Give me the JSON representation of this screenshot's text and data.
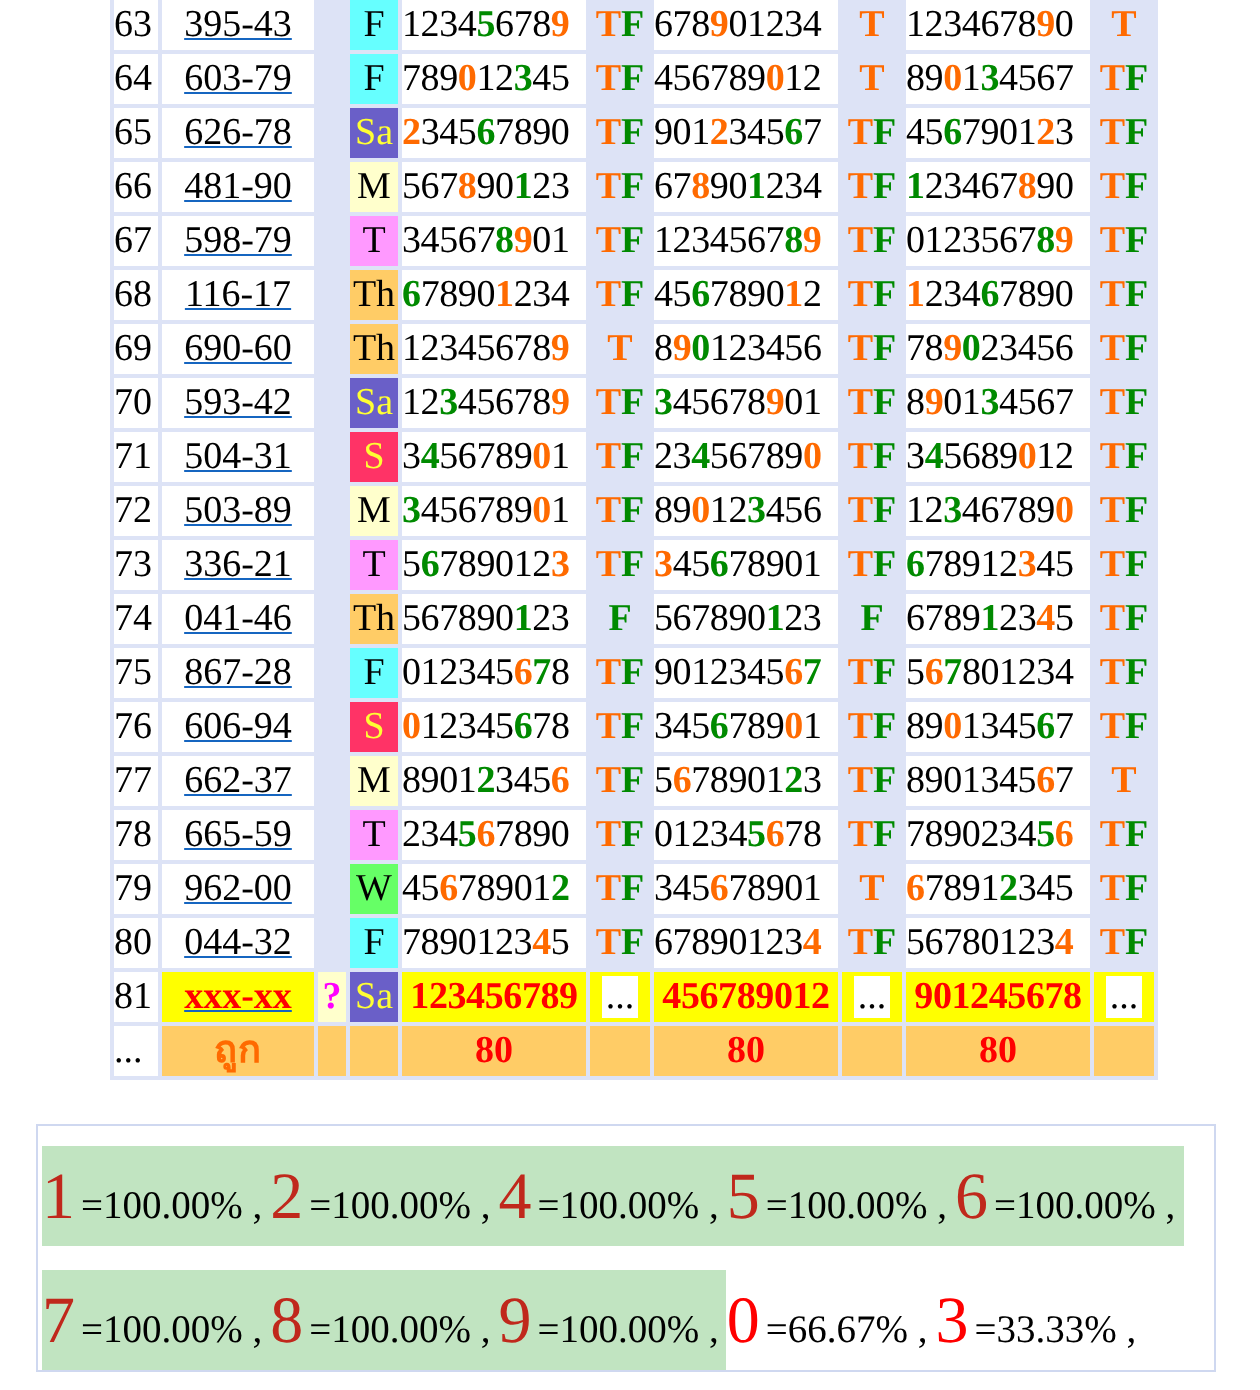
{
  "rows": [
    {
      "n": "63",
      "code": "395-43",
      "day": "F",
      "color": "#66ffff",
      "kind": "past",
      "cells": [
        [
          {
            "text": "1234",
            "color": "#000000"
          },
          {
            "text": "5",
            "color": "#008a00"
          },
          {
            "text": "678",
            "color": "#000000"
          },
          {
            "text": "9",
            "color": "#ff6a00"
          }
        ],
        [
          {
            "text": "T",
            "color": "#ff6a00"
          },
          {
            "text": "F",
            "color": "#008a00"
          }
        ],
        [
          {
            "text": "678",
            "color": "#000000"
          },
          {
            "text": "9",
            "color": "#ff6a00"
          },
          {
            "text": "01234",
            "color": "#000000"
          }
        ],
        [
          {
            "text": "T",
            "color": "#ff6a00"
          }
        ],
        [
          {
            "text": "1234678",
            "color": "#000000"
          },
          {
            "text": "9",
            "color": "#ff6a00"
          },
          {
            "text": "0",
            "color": "#000000"
          }
        ],
        [
          {
            "text": "T",
            "color": "#ff6a00"
          }
        ]
      ]
    },
    {
      "n": "64",
      "code": "603-79",
      "day": "F",
      "color": "#66ffff",
      "kind": "past",
      "cells": [
        [
          {
            "text": "789",
            "color": "#000000"
          },
          {
            "text": "0",
            "color": "#ff6a00"
          },
          {
            "text": "12",
            "color": "#000000"
          },
          {
            "text": "3",
            "color": "#008a00"
          },
          {
            "text": "45",
            "color": "#000000"
          }
        ],
        [
          {
            "text": "T",
            "color": "#ff6a00"
          },
          {
            "text": "F",
            "color": "#008a00"
          }
        ],
        [
          {
            "text": "456789",
            "color": "#000000"
          },
          {
            "text": "0",
            "color": "#ff6a00"
          },
          {
            "text": "12",
            "color": "#000000"
          }
        ],
        [
          {
            "text": "T",
            "color": "#ff6a00"
          }
        ],
        [
          {
            "text": "89",
            "color": "#000000"
          },
          {
            "text": "0",
            "color": "#ff6a00"
          },
          {
            "text": "1",
            "color": "#000000"
          },
          {
            "text": "3",
            "color": "#008a00"
          },
          {
            "text": "4567",
            "color": "#000000"
          }
        ],
        [
          {
            "text": "T",
            "color": "#ff6a00"
          },
          {
            "text": "F",
            "color": "#008a00"
          }
        ]
      ]
    },
    {
      "n": "65",
      "code": "626-78",
      "day": "Sa",
      "color": "#6a5fc8",
      "kind": "past",
      "cells": [
        [
          {
            "text": "2",
            "color": "#ff6a00"
          },
          {
            "text": "345",
            "color": "#000000"
          },
          {
            "text": "6",
            "color": "#008a00"
          },
          {
            "text": "7890",
            "color": "#000000"
          }
        ],
        [
          {
            "text": "T",
            "color": "#ff6a00"
          },
          {
            "text": "F",
            "color": "#008a00"
          }
        ],
        [
          {
            "text": "901",
            "color": "#000000"
          },
          {
            "text": "2",
            "color": "#ff6a00"
          },
          {
            "text": "345",
            "color": "#000000"
          },
          {
            "text": "6",
            "color": "#008a00"
          },
          {
            "text": "7",
            "color": "#000000"
          }
        ],
        [
          {
            "text": "T",
            "color": "#ff6a00"
          },
          {
            "text": "F",
            "color": "#008a00"
          }
        ],
        [
          {
            "text": "45",
            "color": "#000000"
          },
          {
            "text": "6",
            "color": "#008a00"
          },
          {
            "text": "7901",
            "color": "#000000"
          },
          {
            "text": "2",
            "color": "#ff6a00"
          },
          {
            "text": "3",
            "color": "#000000"
          }
        ],
        [
          {
            "text": "T",
            "color": "#ff6a00"
          },
          {
            "text": "F",
            "color": "#008a00"
          }
        ]
      ]
    },
    {
      "n": "66",
      "code": "481-90",
      "day": "M",
      "color": "#ffffcc",
      "kind": "past",
      "cells": [
        [
          {
            "text": "567",
            "color": "#000000"
          },
          {
            "text": "8",
            "color": "#ff6a00"
          },
          {
            "text": "90",
            "color": "#000000"
          },
          {
            "text": "1",
            "color": "#008a00"
          },
          {
            "text": "23",
            "color": "#000000"
          }
        ],
        [
          {
            "text": "T",
            "color": "#ff6a00"
          },
          {
            "text": "F",
            "color": "#008a00"
          }
        ],
        [
          {
            "text": "67",
            "color": "#000000"
          },
          {
            "text": "8",
            "color": "#ff6a00"
          },
          {
            "text": "90",
            "color": "#000000"
          },
          {
            "text": "1",
            "color": "#008a00"
          },
          {
            "text": "234",
            "color": "#000000"
          }
        ],
        [
          {
            "text": "T",
            "color": "#ff6a00"
          },
          {
            "text": "F",
            "color": "#008a00"
          }
        ],
        [
          {
            "text": "1",
            "color": "#008a00"
          },
          {
            "text": "23467",
            "color": "#000000"
          },
          {
            "text": "8",
            "color": "#ff6a00"
          },
          {
            "text": "90",
            "color": "#000000"
          }
        ],
        [
          {
            "text": "T",
            "color": "#ff6a00"
          },
          {
            "text": "F",
            "color": "#008a00"
          }
        ]
      ]
    },
    {
      "n": "67",
      "code": "598-79",
      "day": "T",
      "color": "#ff99ff",
      "kind": "past",
      "cells": [
        [
          {
            "text": "34567",
            "color": "#000000"
          },
          {
            "text": "8",
            "color": "#008a00"
          },
          {
            "text": "9",
            "color": "#ff6a00"
          },
          {
            "text": "01",
            "color": "#000000"
          }
        ],
        [
          {
            "text": "T",
            "color": "#ff6a00"
          },
          {
            "text": "F",
            "color": "#008a00"
          }
        ],
        [
          {
            "text": "1234567",
            "color": "#000000"
          },
          {
            "text": "8",
            "color": "#008a00"
          },
          {
            "text": "9",
            "color": "#ff6a00"
          }
        ],
        [
          {
            "text": "T",
            "color": "#ff6a00"
          },
          {
            "text": "F",
            "color": "#008a00"
          }
        ],
        [
          {
            "text": "0123567",
            "color": "#000000"
          },
          {
            "text": "8",
            "color": "#008a00"
          },
          {
            "text": "9",
            "color": "#ff6a00"
          }
        ],
        [
          {
            "text": "T",
            "color": "#ff6a00"
          },
          {
            "text": "F",
            "color": "#008a00"
          }
        ]
      ]
    },
    {
      "n": "68",
      "code": "116-17",
      "day": "Th",
      "color": "#ffcc66",
      "kind": "past",
      "cells": [
        [
          {
            "text": "6",
            "color": "#008a00"
          },
          {
            "text": "7890",
            "color": "#000000"
          },
          {
            "text": "1",
            "color": "#ff6a00"
          },
          {
            "text": "234",
            "color": "#000000"
          }
        ],
        [
          {
            "text": "T",
            "color": "#ff6a00"
          },
          {
            "text": "F",
            "color": "#008a00"
          }
        ],
        [
          {
            "text": "45",
            "color": "#000000"
          },
          {
            "text": "6",
            "color": "#008a00"
          },
          {
            "text": "7890",
            "color": "#000000"
          },
          {
            "text": "1",
            "color": "#ff6a00"
          },
          {
            "text": "2",
            "color": "#000000"
          }
        ],
        [
          {
            "text": "T",
            "color": "#ff6a00"
          },
          {
            "text": "F",
            "color": "#008a00"
          }
        ],
        [
          {
            "text": "1",
            "color": "#ff6a00"
          },
          {
            "text": "234",
            "color": "#000000"
          },
          {
            "text": "6",
            "color": "#008a00"
          },
          {
            "text": "7890",
            "color": "#000000"
          }
        ],
        [
          {
            "text": "T",
            "color": "#ff6a00"
          },
          {
            "text": "F",
            "color": "#008a00"
          }
        ]
      ]
    },
    {
      "n": "69",
      "code": "690-60",
      "day": "Th",
      "color": "#ffcc66",
      "kind": "past",
      "cells": [
        [
          {
            "text": "12345678",
            "color": "#000000"
          },
          {
            "text": "9",
            "color": "#ff6a00"
          }
        ],
        [
          {
            "text": "T",
            "color": "#ff6a00"
          }
        ],
        [
          {
            "text": "8",
            "color": "#000000"
          },
          {
            "text": "9",
            "color": "#ff6a00"
          },
          {
            "text": "0",
            "color": "#008a00"
          },
          {
            "text": "123456",
            "color": "#000000"
          }
        ],
        [
          {
            "text": "T",
            "color": "#ff6a00"
          },
          {
            "text": "F",
            "color": "#008a00"
          }
        ],
        [
          {
            "text": "78",
            "color": "#000000"
          },
          {
            "text": "9",
            "color": "#ff6a00"
          },
          {
            "text": "0",
            "color": "#008a00"
          },
          {
            "text": "23456",
            "color": "#000000"
          }
        ],
        [
          {
            "text": "T",
            "color": "#ff6a00"
          },
          {
            "text": "F",
            "color": "#008a00"
          }
        ]
      ]
    },
    {
      "n": "70",
      "code": "593-42",
      "day": "Sa",
      "color": "#6a5fc8",
      "kind": "past",
      "cells": [
        [
          {
            "text": "12",
            "color": "#000000"
          },
          {
            "text": "3",
            "color": "#008a00"
          },
          {
            "text": "45678",
            "color": "#000000"
          },
          {
            "text": "9",
            "color": "#ff6a00"
          }
        ],
        [
          {
            "text": "T",
            "color": "#ff6a00"
          },
          {
            "text": "F",
            "color": "#008a00"
          }
        ],
        [
          {
            "text": "3",
            "color": "#008a00"
          },
          {
            "text": "45678",
            "color": "#000000"
          },
          {
            "text": "9",
            "color": "#ff6a00"
          },
          {
            "text": "01",
            "color": "#000000"
          }
        ],
        [
          {
            "text": "T",
            "color": "#ff6a00"
          },
          {
            "text": "F",
            "color": "#008a00"
          }
        ],
        [
          {
            "text": "8",
            "color": "#000000"
          },
          {
            "text": "9",
            "color": "#ff6a00"
          },
          {
            "text": "01",
            "color": "#000000"
          },
          {
            "text": "3",
            "color": "#008a00"
          },
          {
            "text": "4567",
            "color": "#000000"
          }
        ],
        [
          {
            "text": "T",
            "color": "#ff6a00"
          },
          {
            "text": "F",
            "color": "#008a00"
          }
        ]
      ]
    },
    {
      "n": "71",
      "code": "504-31",
      "day": "S",
      "color": "#ff3366",
      "kind": "past",
      "cells": [
        [
          {
            "text": "3",
            "color": "#000000"
          },
          {
            "text": "4",
            "color": "#008a00"
          },
          {
            "text": "56789",
            "color": "#000000"
          },
          {
            "text": "0",
            "color": "#ff6a00"
          },
          {
            "text": "1",
            "color": "#000000"
          }
        ],
        [
          {
            "text": "T",
            "color": "#ff6a00"
          },
          {
            "text": "F",
            "color": "#008a00"
          }
        ],
        [
          {
            "text": "23",
            "color": "#000000"
          },
          {
            "text": "4",
            "color": "#008a00"
          },
          {
            "text": "56789",
            "color": "#000000"
          },
          {
            "text": "0",
            "color": "#ff6a00"
          }
        ],
        [
          {
            "text": "T",
            "color": "#ff6a00"
          },
          {
            "text": "F",
            "color": "#008a00"
          }
        ],
        [
          {
            "text": "3",
            "color": "#000000"
          },
          {
            "text": "4",
            "color": "#008a00"
          },
          {
            "text": "5689",
            "color": "#000000"
          },
          {
            "text": "0",
            "color": "#ff6a00"
          },
          {
            "text": "12",
            "color": "#000000"
          }
        ],
        [
          {
            "text": "T",
            "color": "#ff6a00"
          },
          {
            "text": "F",
            "color": "#008a00"
          }
        ]
      ]
    },
    {
      "n": "72",
      "code": "503-89",
      "day": "M",
      "color": "#ffffcc",
      "kind": "past",
      "cells": [
        [
          {
            "text": "3",
            "color": "#008a00"
          },
          {
            "text": "456789",
            "color": "#000000"
          },
          {
            "text": "0",
            "color": "#ff6a00"
          },
          {
            "text": "1",
            "color": "#000000"
          }
        ],
        [
          {
            "text": "T",
            "color": "#ff6a00"
          },
          {
            "text": "F",
            "color": "#008a00"
          }
        ],
        [
          {
            "text": "89",
            "color": "#000000"
          },
          {
            "text": "0",
            "color": "#ff6a00"
          },
          {
            "text": "12",
            "color": "#000000"
          },
          {
            "text": "3",
            "color": "#008a00"
          },
          {
            "text": "456",
            "color": "#000000"
          }
        ],
        [
          {
            "text": "T",
            "color": "#ff6a00"
          },
          {
            "text": "F",
            "color": "#008a00"
          }
        ],
        [
          {
            "text": "12",
            "color": "#000000"
          },
          {
            "text": "3",
            "color": "#008a00"
          },
          {
            "text": "46789",
            "color": "#000000"
          },
          {
            "text": "0",
            "color": "#ff6a00"
          }
        ],
        [
          {
            "text": "T",
            "color": "#ff6a00"
          },
          {
            "text": "F",
            "color": "#008a00"
          }
        ]
      ]
    },
    {
      "n": "73",
      "code": "336-21",
      "day": "T",
      "color": "#ff99ff",
      "kind": "past",
      "cells": [
        [
          {
            "text": "5",
            "color": "#000000"
          },
          {
            "text": "6",
            "color": "#008a00"
          },
          {
            "text": "789012",
            "color": "#000000"
          },
          {
            "text": "3",
            "color": "#ff6a00"
          }
        ],
        [
          {
            "text": "T",
            "color": "#ff6a00"
          },
          {
            "text": "F",
            "color": "#008a00"
          }
        ],
        [
          {
            "text": "3",
            "color": "#ff6a00"
          },
          {
            "text": "45",
            "color": "#000000"
          },
          {
            "text": "6",
            "color": "#008a00"
          },
          {
            "text": "78901",
            "color": "#000000"
          }
        ],
        [
          {
            "text": "T",
            "color": "#ff6a00"
          },
          {
            "text": "F",
            "color": "#008a00"
          }
        ],
        [
          {
            "text": "6",
            "color": "#008a00"
          },
          {
            "text": "78912",
            "color": "#000000"
          },
          {
            "text": "3",
            "color": "#ff6a00"
          },
          {
            "text": "45",
            "color": "#000000"
          }
        ],
        [
          {
            "text": "T",
            "color": "#ff6a00"
          },
          {
            "text": "F",
            "color": "#008a00"
          }
        ]
      ]
    },
    {
      "n": "74",
      "code": "041-46",
      "day": "Th",
      "color": "#ffcc66",
      "kind": "past",
      "cells": [
        [
          {
            "text": "567890",
            "color": "#000000"
          },
          {
            "text": "1",
            "color": "#008a00"
          },
          {
            "text": "23",
            "color": "#000000"
          }
        ],
        [
          {
            "text": "F",
            "color": "#008a00"
          }
        ],
        [
          {
            "text": "567890",
            "color": "#000000"
          },
          {
            "text": "1",
            "color": "#008a00"
          },
          {
            "text": "23",
            "color": "#000000"
          }
        ],
        [
          {
            "text": "F",
            "color": "#008a00"
          }
        ],
        [
          {
            "text": "6789",
            "color": "#000000"
          },
          {
            "text": "1",
            "color": "#008a00"
          },
          {
            "text": "23",
            "color": "#000000"
          },
          {
            "text": "4",
            "color": "#ff6a00"
          },
          {
            "text": "5",
            "color": "#000000"
          }
        ],
        [
          {
            "text": "T",
            "color": "#ff6a00"
          },
          {
            "text": "F",
            "color": "#008a00"
          }
        ]
      ]
    },
    {
      "n": "75",
      "code": "867-28",
      "day": "F",
      "color": "#66ffff",
      "kind": "past",
      "cells": [
        [
          {
            "text": "012345",
            "color": "#000000"
          },
          {
            "text": "6",
            "color": "#ff6a00"
          },
          {
            "text": "7",
            "color": "#008a00"
          },
          {
            "text": "8",
            "color": "#000000"
          }
        ],
        [
          {
            "text": "T",
            "color": "#ff6a00"
          },
          {
            "text": "F",
            "color": "#008a00"
          }
        ],
        [
          {
            "text": "9012345",
            "color": "#000000"
          },
          {
            "text": "6",
            "color": "#ff6a00"
          },
          {
            "text": "7",
            "color": "#008a00"
          }
        ],
        [
          {
            "text": "T",
            "color": "#ff6a00"
          },
          {
            "text": "F",
            "color": "#008a00"
          }
        ],
        [
          {
            "text": "5",
            "color": "#000000"
          },
          {
            "text": "6",
            "color": "#ff6a00"
          },
          {
            "text": "7",
            "color": "#008a00"
          },
          {
            "text": "801234",
            "color": "#000000"
          }
        ],
        [
          {
            "text": "T",
            "color": "#ff6a00"
          },
          {
            "text": "F",
            "color": "#008a00"
          }
        ]
      ]
    },
    {
      "n": "76",
      "code": "606-94",
      "day": "S",
      "color": "#ff3366",
      "kind": "past",
      "cells": [
        [
          {
            "text": "0",
            "color": "#ff6a00"
          },
          {
            "text": "12345",
            "color": "#000000"
          },
          {
            "text": "6",
            "color": "#008a00"
          },
          {
            "text": "78",
            "color": "#000000"
          }
        ],
        [
          {
            "text": "T",
            "color": "#ff6a00"
          },
          {
            "text": "F",
            "color": "#008a00"
          }
        ],
        [
          {
            "text": "345",
            "color": "#000000"
          },
          {
            "text": "6",
            "color": "#008a00"
          },
          {
            "text": "789",
            "color": "#000000"
          },
          {
            "text": "0",
            "color": "#ff6a00"
          },
          {
            "text": "1",
            "color": "#000000"
          }
        ],
        [
          {
            "text": "T",
            "color": "#ff6a00"
          },
          {
            "text": "F",
            "color": "#008a00"
          }
        ],
        [
          {
            "text": "89",
            "color": "#000000"
          },
          {
            "text": "0",
            "color": "#ff6a00"
          },
          {
            "text": "1345",
            "color": "#000000"
          },
          {
            "text": "6",
            "color": "#008a00"
          },
          {
            "text": "7",
            "color": "#000000"
          }
        ],
        [
          {
            "text": "T",
            "color": "#ff6a00"
          },
          {
            "text": "F",
            "color": "#008a00"
          }
        ]
      ]
    },
    {
      "n": "77",
      "code": "662-37",
      "day": "M",
      "color": "#ffffcc",
      "kind": "past",
      "cells": [
        [
          {
            "text": "8901",
            "color": "#000000"
          },
          {
            "text": "2",
            "color": "#008a00"
          },
          {
            "text": "345",
            "color": "#000000"
          },
          {
            "text": "6",
            "color": "#ff6a00"
          }
        ],
        [
          {
            "text": "T",
            "color": "#ff6a00"
          },
          {
            "text": "F",
            "color": "#008a00"
          }
        ],
        [
          {
            "text": "5",
            "color": "#000000"
          },
          {
            "text": "6",
            "color": "#ff6a00"
          },
          {
            "text": "78901",
            "color": "#000000"
          },
          {
            "text": "2",
            "color": "#008a00"
          },
          {
            "text": "3",
            "color": "#000000"
          }
        ],
        [
          {
            "text": "T",
            "color": "#ff6a00"
          },
          {
            "text": "F",
            "color": "#008a00"
          }
        ],
        [
          {
            "text": "8901345",
            "color": "#000000"
          },
          {
            "text": "6",
            "color": "#ff6a00"
          },
          {
            "text": "7",
            "color": "#000000"
          }
        ],
        [
          {
            "text": "T",
            "color": "#ff6a00"
          }
        ]
      ]
    },
    {
      "n": "78",
      "code": "665-59",
      "day": "T",
      "color": "#ff99ff",
      "kind": "past",
      "cells": [
        [
          {
            "text": "234",
            "color": "#000000"
          },
          {
            "text": "5",
            "color": "#008a00"
          },
          {
            "text": "6",
            "color": "#ff6a00"
          },
          {
            "text": "7890",
            "color": "#000000"
          }
        ],
        [
          {
            "text": "T",
            "color": "#ff6a00"
          },
          {
            "text": "F",
            "color": "#008a00"
          }
        ],
        [
          {
            "text": "01234",
            "color": "#000000"
          },
          {
            "text": "5",
            "color": "#008a00"
          },
          {
            "text": "6",
            "color": "#ff6a00"
          },
          {
            "text": "78",
            "color": "#000000"
          }
        ],
        [
          {
            "text": "T",
            "color": "#ff6a00"
          },
          {
            "text": "F",
            "color": "#008a00"
          }
        ],
        [
          {
            "text": "7890234",
            "color": "#000000"
          },
          {
            "text": "5",
            "color": "#008a00"
          },
          {
            "text": "6",
            "color": "#ff6a00"
          }
        ],
        [
          {
            "text": "T",
            "color": "#ff6a00"
          },
          {
            "text": "F",
            "color": "#008a00"
          }
        ]
      ]
    },
    {
      "n": "79",
      "code": "962-00",
      "day": "W",
      "color": "#66ff66",
      "kind": "past",
      "cells": [
        [
          {
            "text": "45",
            "color": "#000000"
          },
          {
            "text": "6",
            "color": "#ff6a00"
          },
          {
            "text": "78901",
            "color": "#000000"
          },
          {
            "text": "2",
            "color": "#008a00"
          }
        ],
        [
          {
            "text": "T",
            "color": "#ff6a00"
          },
          {
            "text": "F",
            "color": "#008a00"
          }
        ],
        [
          {
            "text": "345",
            "color": "#000000"
          },
          {
            "text": "6",
            "color": "#ff6a00"
          },
          {
            "text": "78901",
            "color": "#000000"
          }
        ],
        [
          {
            "text": "T",
            "color": "#ff6a00"
          }
        ],
        [
          {
            "text": "6",
            "color": "#ff6a00"
          },
          {
            "text": "7891",
            "color": "#000000"
          },
          {
            "text": "2",
            "color": "#008a00"
          },
          {
            "text": "345",
            "color": "#000000"
          }
        ],
        [
          {
            "text": "T",
            "color": "#ff6a00"
          },
          {
            "text": "F",
            "color": "#008a00"
          }
        ]
      ]
    },
    {
      "n": "80",
      "code": "044-32",
      "day": "F",
      "color": "#66ffff",
      "kind": "past",
      "cells": [
        [
          {
            "text": "7890123",
            "color": "#000000"
          },
          {
            "text": "4",
            "color": "#ff6a00"
          },
          {
            "text": "5",
            "color": "#000000"
          }
        ],
        [
          {
            "text": "T",
            "color": "#ff6a00"
          },
          {
            "text": "F",
            "color": "#008a00"
          }
        ],
        [
          {
            "text": "67890123",
            "color": "#000000"
          },
          {
            "text": "4",
            "color": "#ff6a00"
          }
        ],
        [
          {
            "text": "T",
            "color": "#ff6a00"
          },
          {
            "text": "F",
            "color": "#008a00"
          }
        ],
        [
          {
            "text": "56780123",
            "color": "#000000"
          },
          {
            "text": "4",
            "color": "#ff6a00"
          }
        ],
        [
          {
            "text": "T",
            "color": "#ff6a00"
          },
          {
            "text": "F",
            "color": "#008a00"
          }
        ]
      ]
    },
    {
      "n": "81",
      "code": "xxx-xx",
      "flag": "?",
      "day": "Sa",
      "color": "#6a5fc8",
      "kind": "pending",
      "cells": [
        [
          {
            "text": "123456789",
            "color": "#ff0000"
          }
        ],
        [
          {
            "text": "...",
            "color": "#000000"
          }
        ],
        [
          {
            "text": "456789012",
            "color": "#ff0000"
          }
        ],
        [
          {
            "text": "...",
            "color": "#000000"
          }
        ],
        [
          {
            "text": "901245678",
            "color": "#ff0000"
          }
        ],
        [
          {
            "text": "...",
            "color": "#000000"
          }
        ]
      ]
    }
  ],
  "footer": {
    "first": "...",
    "label": "ถูก",
    "counts": [
      "80",
      "80",
      "80"
    ]
  },
  "stats": [
    {
      "digit": "1",
      "value": "=100.00% ,",
      "hit": true
    },
    {
      "digit": "2",
      "value": "=100.00% ,",
      "hit": true
    },
    {
      "digit": "4",
      "value": "=100.00% ,",
      "hit": true
    },
    {
      "digit": "5",
      "value": "=100.00% ,",
      "hit": true
    },
    {
      "digit": "6",
      "value": "=100.00% ,",
      "hit": true
    },
    {
      "digit": "7",
      "value": "=100.00% ,",
      "hit": true
    },
    {
      "digit": "8",
      "value": "=100.00% ,",
      "hit": true
    },
    {
      "digit": "9",
      "value": "=100.00% ,",
      "hit": true
    },
    {
      "digit": "0",
      "value": "=66.67% ,",
      "hit": false
    },
    {
      "digit": "3",
      "value": "=33.33% ,",
      "hit": false
    }
  ]
}
